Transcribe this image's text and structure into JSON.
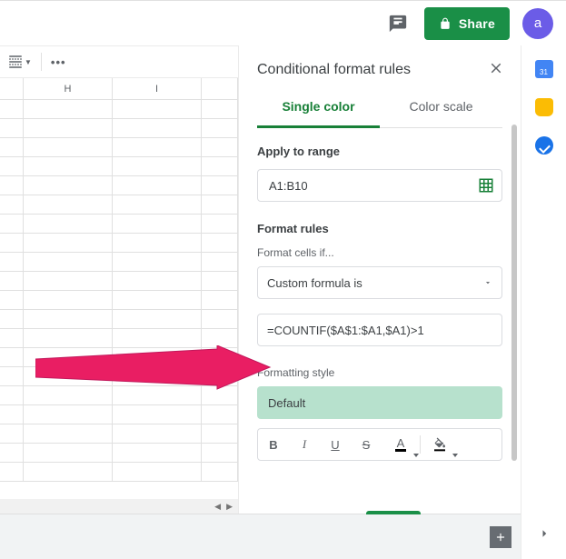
{
  "header": {
    "share_label": "Share",
    "avatar_letter": "a"
  },
  "sheet": {
    "columns": [
      "H",
      "I"
    ]
  },
  "panel": {
    "title": "Conditional format rules",
    "tabs": {
      "single": "Single color",
      "scale": "Color scale"
    },
    "apply_to_range_label": "Apply to range",
    "range_value": "A1:B10",
    "format_rules_label": "Format rules",
    "format_cells_if_label": "Format cells if...",
    "condition_type": "Custom formula is",
    "formula_value": "=COUNTIF($A$1:$A1,$A1)>1",
    "formatting_style_label": "Formatting style",
    "style_preview_text": "Default"
  }
}
